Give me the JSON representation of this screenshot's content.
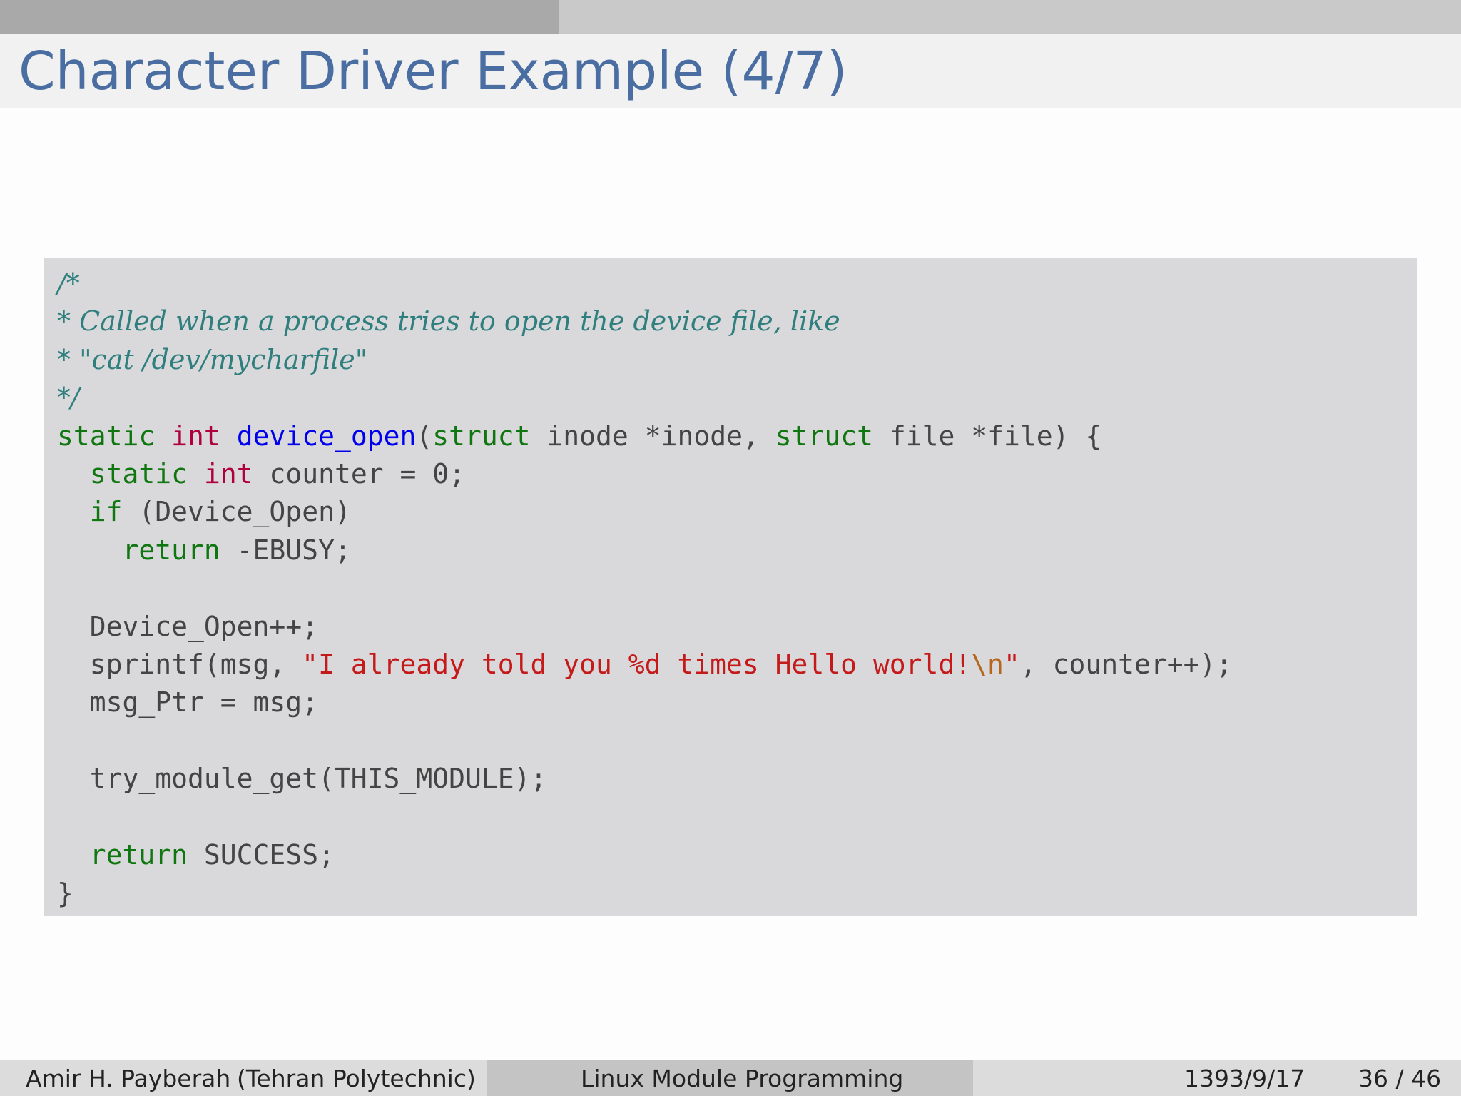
{
  "slide": {
    "title": "Character Driver Example (4/7)",
    "progress_fraction": 0.383
  },
  "code": {
    "lines": [
      [
        {
          "t": "/*",
          "c": "cm"
        }
      ],
      [
        {
          "t": "* Called when a process tries to open the device file, like",
          "c": "cm"
        }
      ],
      [
        {
          "t": "* \"cat /dev/mycharfile\"",
          "c": "cm"
        }
      ],
      [
        {
          "t": "*/",
          "c": "cm"
        }
      ],
      [
        {
          "t": "static",
          "c": "kw"
        },
        {
          "t": " ",
          "c": "tx"
        },
        {
          "t": "int",
          "c": "ty"
        },
        {
          "t": " ",
          "c": "tx"
        },
        {
          "t": "device_open",
          "c": "fn"
        },
        {
          "t": "(",
          "c": "tx"
        },
        {
          "t": "struct",
          "c": "kw"
        },
        {
          "t": " inode *inode, ",
          "c": "tx"
        },
        {
          "t": "struct",
          "c": "kw"
        },
        {
          "t": " file *file) {",
          "c": "tx"
        }
      ],
      [
        {
          "t": "  ",
          "c": "tx"
        },
        {
          "t": "static",
          "c": "kw"
        },
        {
          "t": " ",
          "c": "tx"
        },
        {
          "t": "int",
          "c": "ty"
        },
        {
          "t": " counter = 0;",
          "c": "tx"
        }
      ],
      [
        {
          "t": "  ",
          "c": "tx"
        },
        {
          "t": "if",
          "c": "kw"
        },
        {
          "t": " (Device_Open)",
          "c": "tx"
        }
      ],
      [
        {
          "t": "    ",
          "c": "tx"
        },
        {
          "t": "return",
          "c": "kw"
        },
        {
          "t": " -EBUSY;",
          "c": "tx"
        }
      ],
      [],
      [
        {
          "t": "  Device_Open++;",
          "c": "tx"
        }
      ],
      [
        {
          "t": "  sprintf(msg, ",
          "c": "tx"
        },
        {
          "t": "\"I already told you %d times Hello world!",
          "c": "st"
        },
        {
          "t": "\\n",
          "c": "es"
        },
        {
          "t": "\"",
          "c": "st"
        },
        {
          "t": ", counter++);",
          "c": "tx"
        }
      ],
      [
        {
          "t": "  msg_Ptr = msg;",
          "c": "tx"
        }
      ],
      [],
      [
        {
          "t": "  try_module_get(THIS_MODULE);",
          "c": "tx"
        }
      ],
      [],
      [
        {
          "t": "  ",
          "c": "tx"
        },
        {
          "t": "return",
          "c": "kw"
        },
        {
          "t": " SUCCESS;",
          "c": "tx"
        }
      ],
      [
        {
          "t": "}",
          "c": "tx"
        }
      ]
    ]
  },
  "footer": {
    "author": "Amir H. Payberah",
    "institution": "(Tehran Polytechnic)",
    "talk_title": "Linux Module Programming",
    "date": "1393/9/17",
    "page": "36 / 46"
  }
}
